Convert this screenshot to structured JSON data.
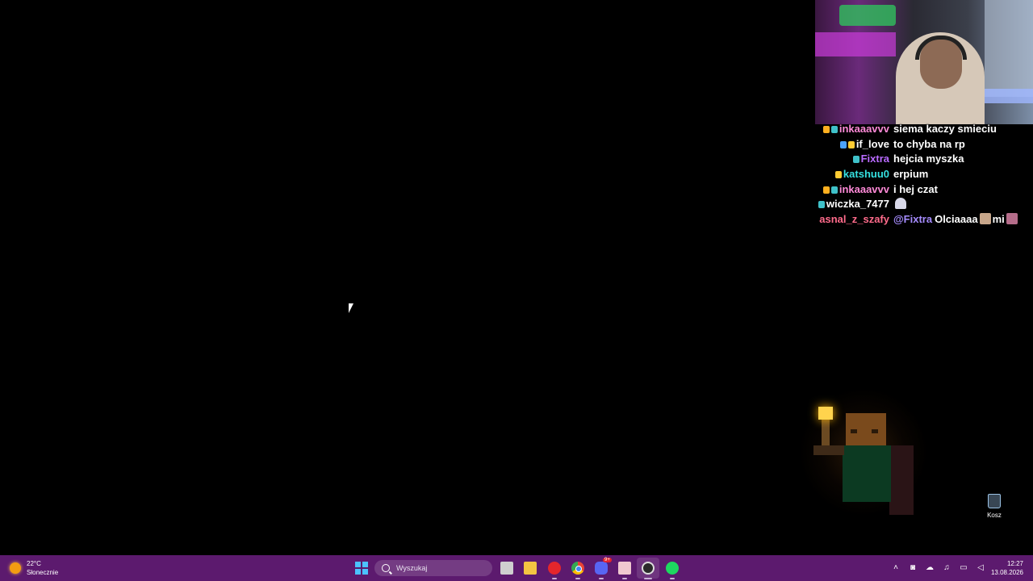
{
  "chat": [
    {
      "user": "inkaaavvv",
      "color": "#ff8ad8",
      "badges": [
        "#ffb020",
        "#3fc1c9"
      ],
      "message": "siema kaczy smieciu"
    },
    {
      "user": "if_love",
      "color": "#ffffff",
      "badges": [
        "#4aa3ff",
        "#ffcc33"
      ],
      "message": "to chyba na rp"
    },
    {
      "user": "Fixtra",
      "color": "#b96bff",
      "badges": [
        "#3fc1c9"
      ],
      "message": "hejcia myszka"
    },
    {
      "user": "katshuu0",
      "color": "#35e0e0",
      "badges": [
        "#ffcc33"
      ],
      "message": "erpium"
    },
    {
      "user": "inkaaavvv",
      "color": "#ff8ad8",
      "badges": [
        "#ffb020",
        "#3fc1c9"
      ],
      "message": "i hej czat"
    },
    {
      "user": "wiczka_7477",
      "color": "#ffffff",
      "badges": [
        "#3fc1c9"
      ],
      "message": ""
    },
    {
      "user": "asnal_z_szafy",
      "color": "#ff6b8b",
      "badges": [],
      "mention": "@Fixtra",
      "message": "Olciaaaa",
      "message_tail": "mi"
    }
  ],
  "desktop": {
    "recycle_bin_label": "Kosz"
  },
  "taskbar": {
    "weather_temp": "22°C",
    "weather_desc": "Słonecznie",
    "search_placeholder": "Wyszukaj",
    "discord_badge": "9+",
    "time": "12:27",
    "date": "13.08.2026"
  },
  "icons": {
    "start": "windows-start-icon",
    "search": "search-icon",
    "task_view": "task-view-icon",
    "file_explorer": "folder-icon",
    "youtube_music": "youtube-music-icon",
    "chrome": "chrome-icon",
    "discord": "discord-icon",
    "paint": "paint-icon",
    "obs": "obs-icon",
    "spotify": "spotify-icon"
  },
  "colors": {
    "taskbar": "#5c1a6e",
    "accent": "#4cc2ff"
  }
}
